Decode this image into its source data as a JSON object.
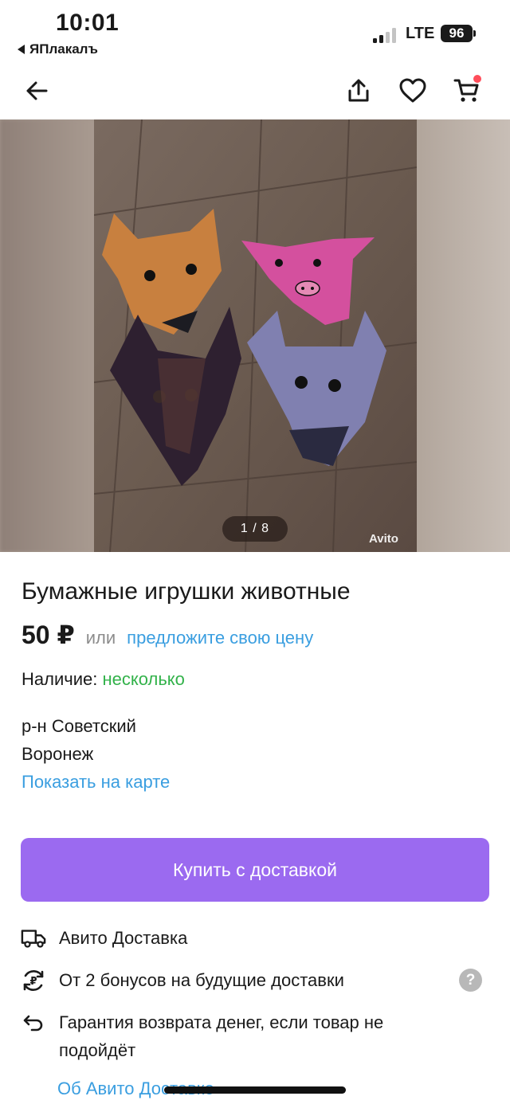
{
  "status_bar": {
    "time": "10:01",
    "back_app": "ЯПлакалъ",
    "network": "LTE",
    "battery": "96"
  },
  "nav": {
    "back_icon": "arrow-left-icon",
    "share_icon": "share-icon",
    "favorite_icon": "heart-icon",
    "cart_icon": "cart-icon",
    "cart_badge_color": "#ff4d5a"
  },
  "gallery": {
    "counter": "1 / 8",
    "watermark": "Avito"
  },
  "listing": {
    "title": "Бумажные игрушки животные",
    "price": "50 ₽",
    "or": "или",
    "offer_link": "предложите свою цену",
    "availability_label": "Наличие:",
    "availability_value": "несколько",
    "district": "р-н Советский",
    "city": "Воронеж",
    "map_link": "Показать на карте"
  },
  "buy_button": {
    "label": "Купить с доставкой",
    "color": "#9b6af0"
  },
  "features": [
    {
      "icon": "truck-icon",
      "text": "Авито Доставка"
    },
    {
      "icon": "bonus-icon",
      "text": "От 2 бонусов на будущие доставки"
    },
    {
      "icon": "return-arrow-icon",
      "text": "Гарантия возврата денег, если товар не подойдёт"
    }
  ],
  "help_icon": "?",
  "about_link": "Об Авито Доставке",
  "colors": {
    "link": "#3a9ee0",
    "available": "#32b24a",
    "muted": "#8c8c8c"
  }
}
